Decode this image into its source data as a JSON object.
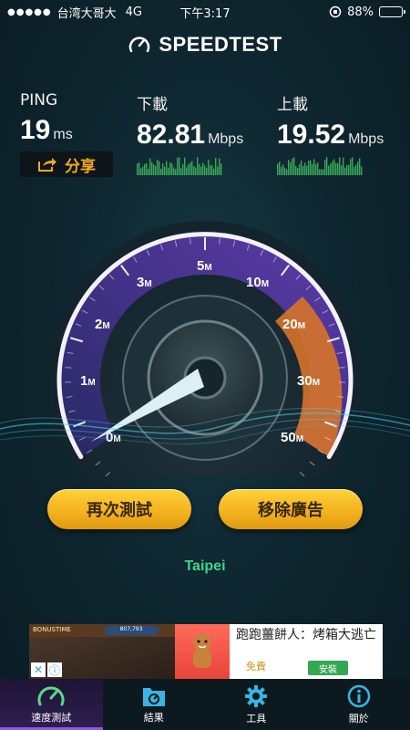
{
  "status": {
    "signal": "●●●●●",
    "carrier": "台湾大哥大",
    "network": "4G",
    "time": "下午3:17",
    "battery_pct": "88%",
    "battery_level": 0.88
  },
  "app": {
    "title": "SPEEDTEST"
  },
  "results": {
    "ping": {
      "label": "PING",
      "value": "19",
      "unit": "ms"
    },
    "download": {
      "label": "下載",
      "value": "82.81",
      "unit": "Mbps"
    },
    "upload": {
      "label": "上載",
      "value": "19.52",
      "unit": "Mbps"
    }
  },
  "share_label": "分享",
  "gauge": {
    "ticks": [
      {
        "num": "0",
        "unit": "M"
      },
      {
        "num": "1",
        "unit": "M"
      },
      {
        "num": "2",
        "unit": "M"
      },
      {
        "num": "3",
        "unit": "M"
      },
      {
        "num": "5",
        "unit": "M"
      },
      {
        "num": "10",
        "unit": "M"
      },
      {
        "num": "20",
        "unit": "M"
      },
      {
        "num": "30",
        "unit": "M"
      },
      {
        "num": "50",
        "unit": "M"
      }
    ]
  },
  "buttons": {
    "retest": "再次測試",
    "remove_ads": "移除廣告"
  },
  "server": "Taipei",
  "ad": {
    "game_bar": "BONUSTIME",
    "game_score": "807,793",
    "title": "跑跑薑餅人：烤箱大逃亡",
    "free": "免費",
    "install": "安裝"
  },
  "tabs": [
    {
      "label": "速度測試",
      "icon": "speedometer-icon"
    },
    {
      "label": "結果",
      "icon": "results-icon"
    },
    {
      "label": "工具",
      "icon": "gear-icon"
    },
    {
      "label": "關於",
      "icon": "info-icon"
    }
  ],
  "colors": {
    "accent": "#f5a623",
    "server": "#3fd68a",
    "needle": "#dceff5",
    "arc_purple": "#5b3fb0",
    "arc_orange": "#e07a2a"
  }
}
